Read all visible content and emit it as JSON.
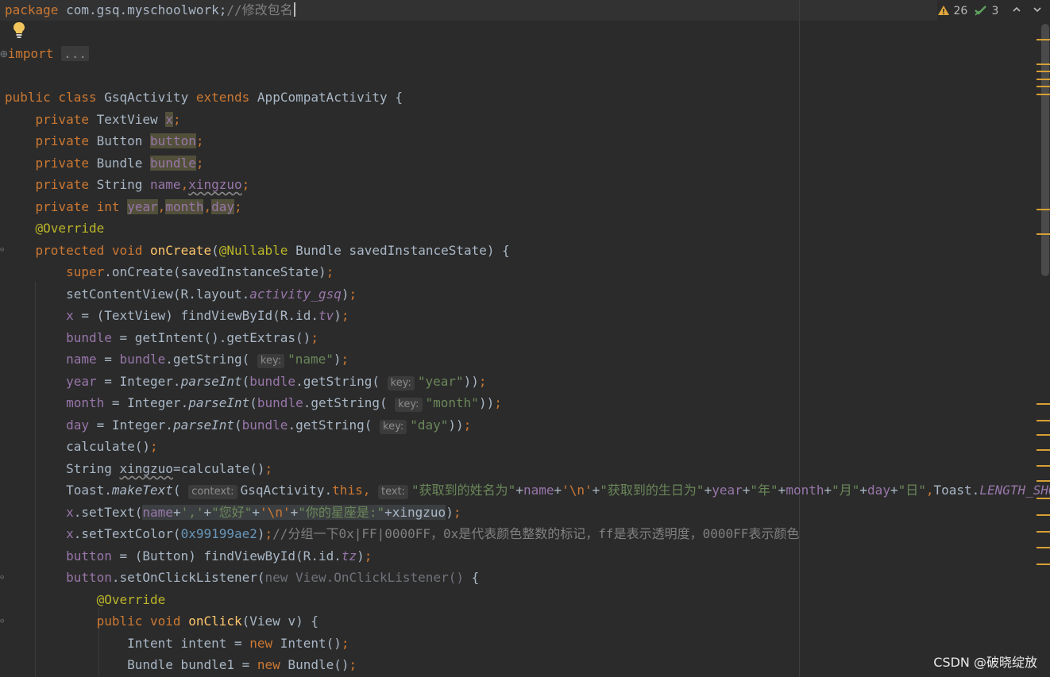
{
  "editor": {
    "file": {
      "package_name": "com.gsq.myschoolwork",
      "package_comment": "//修改包名",
      "folded_placeholder": "...",
      "class_name": "GsqActivity",
      "parent_class": "AppCompatActivity",
      "color_hex": "0x99199ae2",
      "color_comment": "//分组一下0x|FF|0000FF，0x是代表颜色整数的标记，ff是表示透明度，0000FF表示颜色",
      "toast_name_prefix": "\"获取到的姓名为\"",
      "toast_birthday_prefix": "\"获取到的生日为\"",
      "year_suffix": "\"年\"",
      "month_suffix": "\"月\"",
      "day_suffix": "\"日\"",
      "greeting": "\"您好\"",
      "zodiac_prefix": "\"你的星座是:\"",
      "newline_literal": "'\\n'",
      "comma_literal": "','",
      "key_name": "\"name\"",
      "key_year": "\"year\"",
      "key_month": "\"month\"",
      "key_day": "\"day\"",
      "hint_key": "key:",
      "hint_context": "context:",
      "hint_text": "text:"
    }
  },
  "status": {
    "warnings_count": "26",
    "weak_warnings_count": "3"
  },
  "colors": {
    "background": "#2b2b2b",
    "keyword": "#cc7832",
    "field": "#9876aa",
    "method": "#ffc66d",
    "string": "#6a8759",
    "number": "#6897bb",
    "annotation": "#bbb529",
    "warning_stripe": "#d8a034"
  },
  "watermark": {
    "text": "CSDN @破晓绽放"
  }
}
